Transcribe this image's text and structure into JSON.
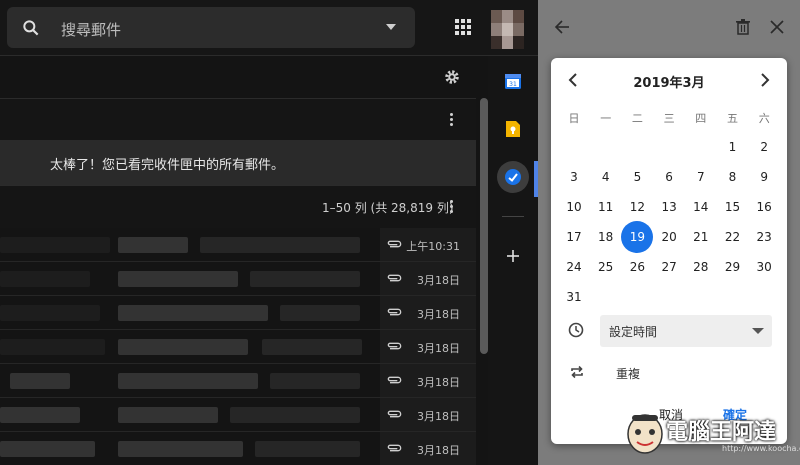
{
  "search": {
    "placeholder": "搜尋郵件"
  },
  "banner": {
    "text": "太棒了！您已看完收件匣中的所有郵件。"
  },
  "pager": {
    "range": "1–50 列 (共 28,819 列)"
  },
  "mails": [
    {
      "date": "上午10:31"
    },
    {
      "date": "3月18日"
    },
    {
      "date": "3月18日"
    },
    {
      "date": "3月18日"
    },
    {
      "date": "3月18日"
    },
    {
      "date": "3月18日"
    },
    {
      "date": "3月18日"
    }
  ],
  "calendar": {
    "title": "2019年3月",
    "weekdays": [
      "日",
      "一",
      "二",
      "三",
      "四",
      "五",
      "六"
    ],
    "days": [
      "1",
      "2",
      "3",
      "4",
      "5",
      "6",
      "7",
      "8",
      "9",
      "10",
      "11",
      "12",
      "13",
      "14",
      "15",
      "16",
      "17",
      "18",
      "19",
      "20",
      "21",
      "22",
      "23",
      "24",
      "25",
      "26",
      "27",
      "28",
      "29",
      "30",
      "31"
    ],
    "selected": "19",
    "time_label": "設定時間",
    "repeat_label": "重複",
    "cancel_label": "取消",
    "ok_label": "確定"
  },
  "watermark": {
    "text": "電腦王阿達",
    "url": "http://www.koocha.com.tw"
  },
  "colors": {
    "accent": "#1a73e8",
    "panel_bg": "#7c7c7c",
    "dark_bg": "#141414"
  }
}
